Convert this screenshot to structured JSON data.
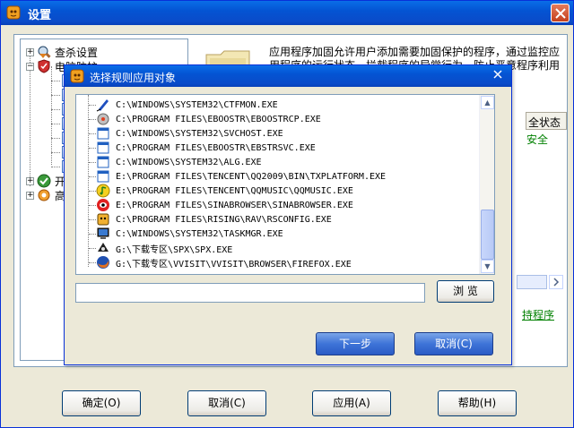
{
  "main_window": {
    "title": "设置",
    "tree": [
      {
        "label": "查杀设置",
        "icon": "magnifier-shield-icon"
      },
      {
        "label": "电脑防护",
        "icon": "shield-red-icon"
      },
      {
        "label": "开",
        "icon": "green-check-icon"
      },
      {
        "label": "高",
        "icon": "orange-gear-icon"
      }
    ],
    "info_text": "应用程序加固允许用户添加需要加固保护的程序，通过监控应用程序的运行状态，拦截程序的异常行为，防止恶意程序利用应用程序来窃取用户敏感资料。",
    "status_header": "全状态",
    "status_value": "安全",
    "protect_link": "持程序",
    "buttons": {
      "ok": "确定(O)",
      "cancel": "取消(C)",
      "apply": "应用(A)",
      "help": "帮助(H)"
    }
  },
  "dialog": {
    "title": "选择规则应用对象",
    "files": [
      {
        "path": "C:\\WINDOWS\\SYSTEM32\\CTFMON.EXE",
        "icon": "pen-icon"
      },
      {
        "path": "C:\\PROGRAM FILES\\EBOOSTR\\EBOOSTRCP.EXE",
        "icon": "gear-disc-icon"
      },
      {
        "path": "C:\\WINDOWS\\SYSTEM32\\SVCHOST.EXE",
        "icon": "window-icon"
      },
      {
        "path": "C:\\PROGRAM FILES\\EBOOSTR\\EBSTRSVC.EXE",
        "icon": "window-icon"
      },
      {
        "path": "C:\\WINDOWS\\SYSTEM32\\ALG.EXE",
        "icon": "window-icon"
      },
      {
        "path": "E:\\PROGRAM FILES\\TENCENT\\QQ2009\\BIN\\TXPLATFORM.EXE",
        "icon": "window-icon"
      },
      {
        "path": "E:\\PROGRAM FILES\\TENCENT\\QQMUSIC\\QQMUSIC.EXE",
        "icon": "qqmusic-icon"
      },
      {
        "path": "E:\\PROGRAM FILES\\SINABROWSER\\SINABROWSER.EXE",
        "icon": "sina-eye-icon"
      },
      {
        "path": "C:\\PROGRAM FILES\\RISING\\RAV\\RSCONFIG.EXE",
        "icon": "rising-lion-icon"
      },
      {
        "path": "C:\\WINDOWS\\SYSTEM32\\TASKMGR.EXE",
        "icon": "computer-icon"
      },
      {
        "path": "G:\\下载专区\\SPX\\SPX.EXE",
        "icon": "spx-icon"
      },
      {
        "path": "G:\\下载专区\\VVISIT\\VVISIT\\BROWSER\\FIREFOX.EXE",
        "icon": "firefox-icon"
      }
    ],
    "path_value": "",
    "browse_label": "浏 览",
    "next_label": "下一步",
    "cancel_label": "取消(C)"
  },
  "colors": {
    "titlebar": "#0454d3",
    "accent_green": "#008000",
    "frame": "#ece9d8"
  }
}
